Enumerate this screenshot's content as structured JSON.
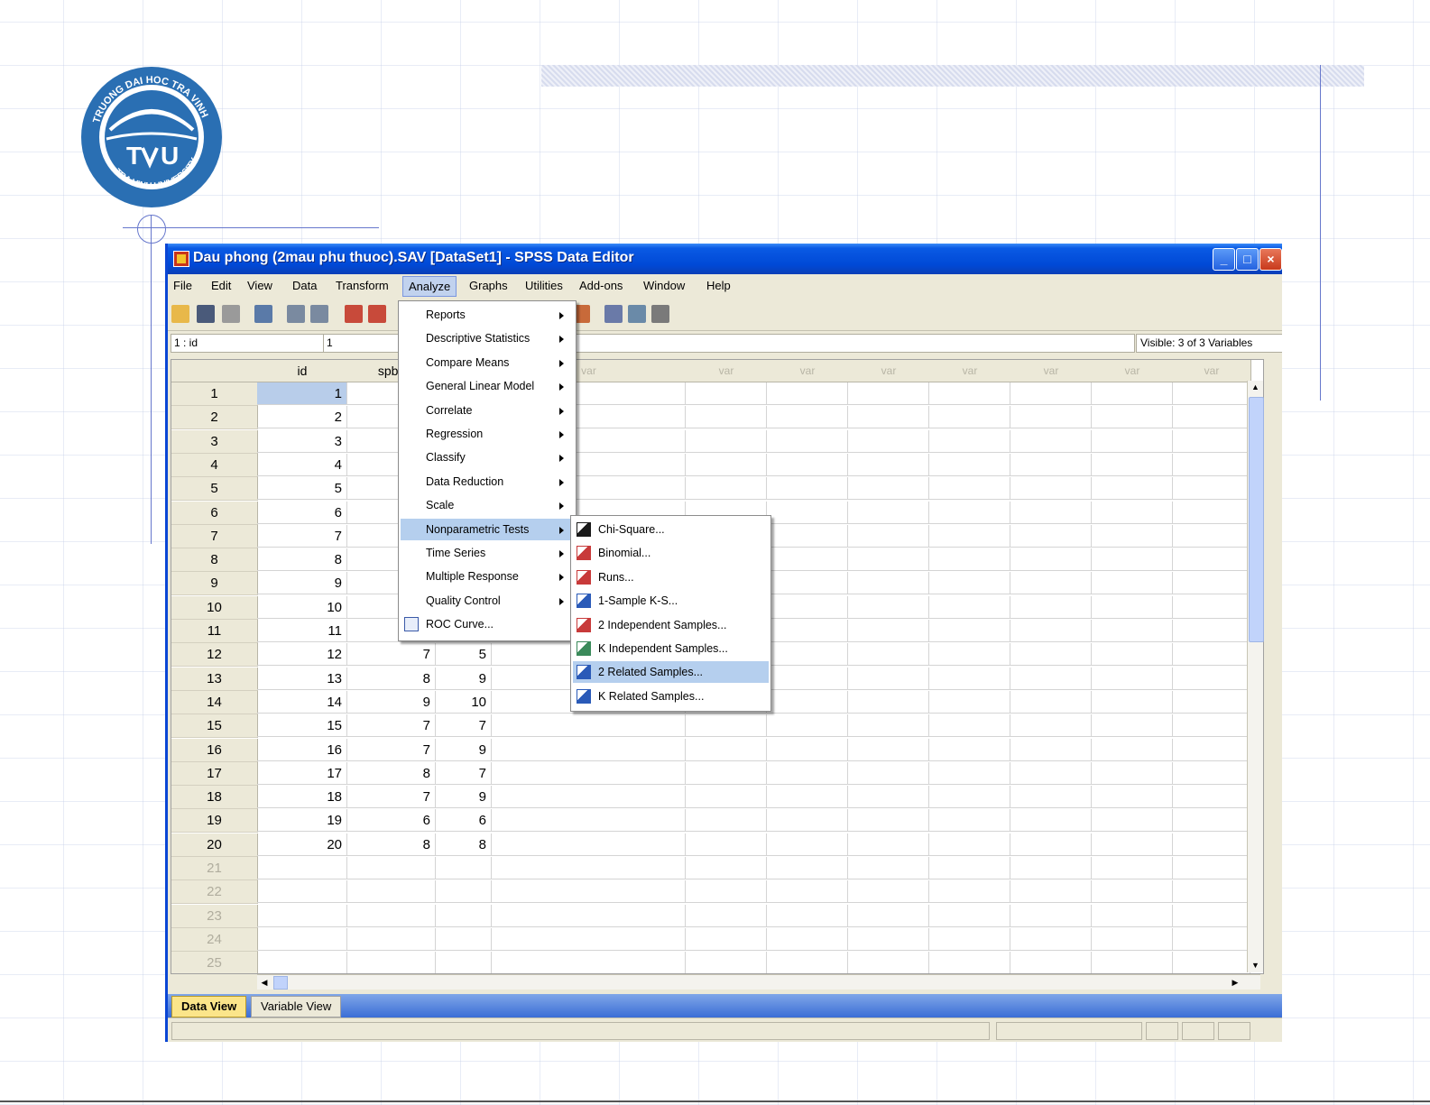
{
  "window": {
    "title": "Dau phong (2mau phu thuoc).SAV [DataSet1] - SPSS Data Editor",
    "minimize_glyph": "_",
    "maximize_glyph": "□",
    "close_glyph": "×"
  },
  "menubar": [
    "File",
    "Edit",
    "View",
    "Data",
    "Transform",
    "Analyze",
    "Graphs",
    "Utilities",
    "Add-ons",
    "Window",
    "Help"
  ],
  "cell_editor": {
    "name": "1 : id",
    "value": "1",
    "visible": "Visible: 3 of 3 Variables"
  },
  "grid": {
    "columns": [
      "id",
      "spba",
      "",
      "var",
      "var",
      "var",
      "var",
      "var",
      "var",
      "var",
      "var"
    ],
    "rows": [
      {
        "n": "1",
        "id": "1",
        "a": "",
        "b": ""
      },
      {
        "n": "2",
        "id": "2",
        "a": "",
        "b": ""
      },
      {
        "n": "3",
        "id": "3",
        "a": "",
        "b": ""
      },
      {
        "n": "4",
        "id": "4",
        "a": "",
        "b": ""
      },
      {
        "n": "5",
        "id": "5",
        "a": "",
        "b": ""
      },
      {
        "n": "6",
        "id": "6",
        "a": "",
        "b": ""
      },
      {
        "n": "7",
        "id": "7",
        "a": "",
        "b": ""
      },
      {
        "n": "8",
        "id": "8",
        "a": "",
        "b": ""
      },
      {
        "n": "9",
        "id": "9",
        "a": "",
        "b": ""
      },
      {
        "n": "10",
        "id": "10",
        "a": "",
        "b": ""
      },
      {
        "n": "11",
        "id": "11",
        "a": "",
        "b": ""
      },
      {
        "n": "12",
        "id": "12",
        "a": "7",
        "b": "5"
      },
      {
        "n": "13",
        "id": "13",
        "a": "8",
        "b": "9"
      },
      {
        "n": "14",
        "id": "14",
        "a": "9",
        "b": "10"
      },
      {
        "n": "15",
        "id": "15",
        "a": "7",
        "b": "7"
      },
      {
        "n": "16",
        "id": "16",
        "a": "7",
        "b": "9"
      },
      {
        "n": "17",
        "id": "17",
        "a": "8",
        "b": "7"
      },
      {
        "n": "18",
        "id": "18",
        "a": "7",
        "b": "9"
      },
      {
        "n": "19",
        "id": "19",
        "a": "6",
        "b": "6"
      },
      {
        "n": "20",
        "id": "20",
        "a": "8",
        "b": "8"
      },
      {
        "n": "21",
        "id": "",
        "a": "",
        "b": ""
      },
      {
        "n": "22",
        "id": "",
        "a": "",
        "b": ""
      },
      {
        "n": "23",
        "id": "",
        "a": "",
        "b": ""
      },
      {
        "n": "24",
        "id": "",
        "a": "",
        "b": ""
      },
      {
        "n": "25",
        "id": "",
        "a": "",
        "b": ""
      }
    ]
  },
  "analyze_menu": [
    {
      "label": "Reports",
      "submenu": true
    },
    {
      "label": "Descriptive Statistics",
      "submenu": true
    },
    {
      "label": "Compare Means",
      "submenu": true
    },
    {
      "label": "General Linear Model",
      "submenu": true
    },
    {
      "label": "Correlate",
      "submenu": true
    },
    {
      "label": "Regression",
      "submenu": true
    },
    {
      "label": "Classify",
      "submenu": true
    },
    {
      "label": "Data Reduction",
      "submenu": true
    },
    {
      "label": "Scale",
      "submenu": true
    },
    {
      "label": "Nonparametric Tests",
      "submenu": true,
      "highlighted": true
    },
    {
      "label": "Time Series",
      "submenu": true
    },
    {
      "label": "Multiple Response",
      "submenu": true
    },
    {
      "label": "Quality Control",
      "submenu": true
    },
    {
      "label": "ROC Curve...",
      "submenu": false,
      "icon": "roc-curve-icon"
    }
  ],
  "nonparametric_menu": [
    {
      "label": "Chi-Square...",
      "icon": "chi-square-icon"
    },
    {
      "label": "Binomial...",
      "icon": "binomial-icon"
    },
    {
      "label": "Runs...",
      "icon": "runs-icon"
    },
    {
      "label": "1-Sample K-S...",
      "icon": "one-sample-ks-icon"
    },
    {
      "label": "2 Independent Samples...",
      "icon": "two-independent-icon"
    },
    {
      "label": "K Independent Samples...",
      "icon": "k-independent-icon"
    },
    {
      "label": "2 Related Samples...",
      "icon": "two-related-icon",
      "highlighted": true
    },
    {
      "label": "K Related Samples...",
      "icon": "k-related-icon"
    }
  ],
  "tabs": [
    "Data View",
    "Variable View"
  ],
  "colors": {
    "titlebar": "#0a5ae4",
    "menu_highlight": "#b5cfee",
    "selected_cell": "#b8cdea",
    "active_tab": "#fbe58a"
  }
}
